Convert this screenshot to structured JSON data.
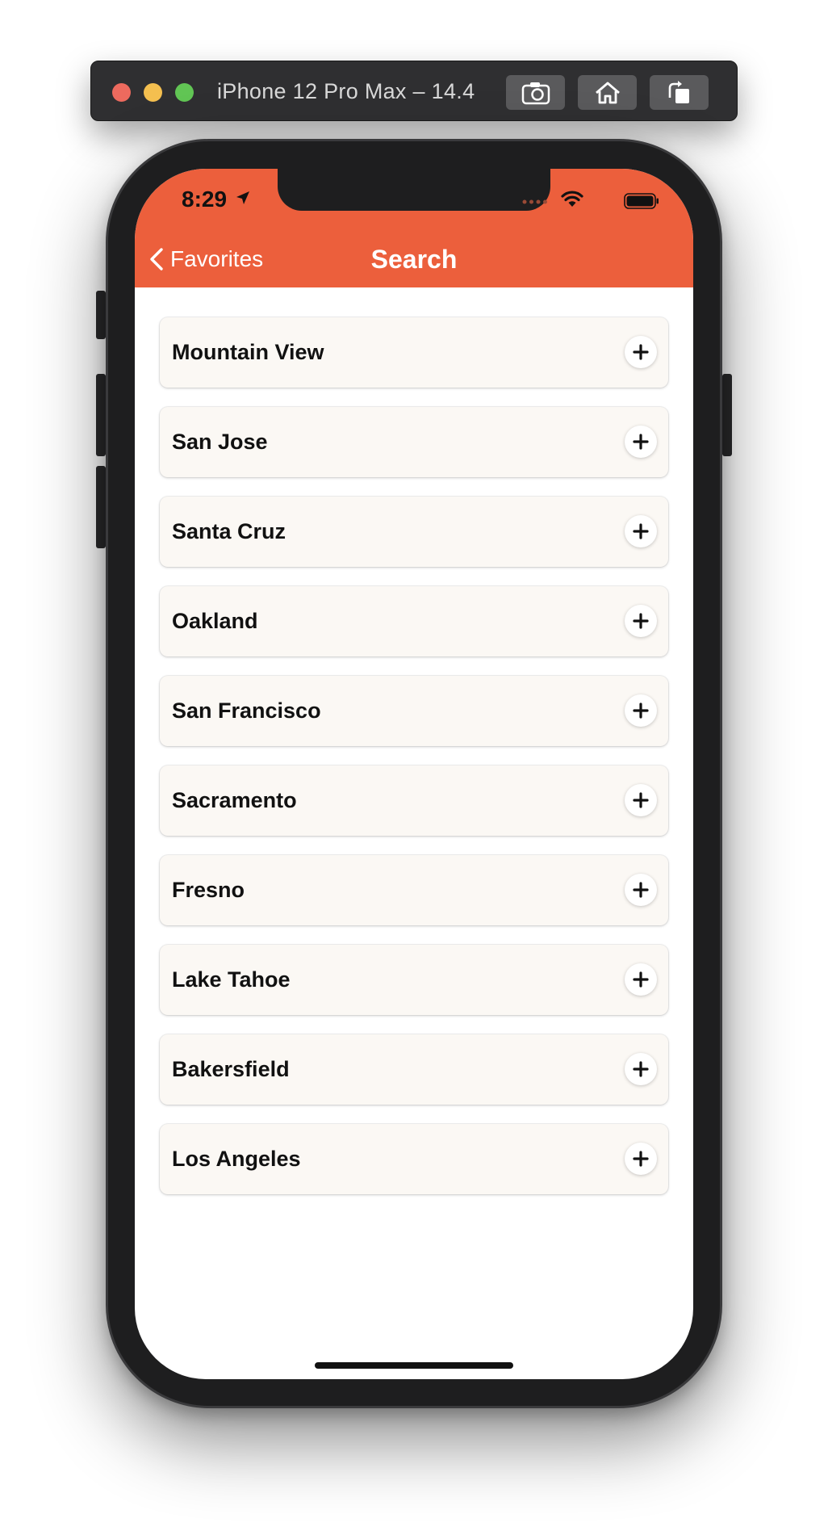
{
  "simulator": {
    "title": "iPhone 12 Pro Max – 14.4",
    "buttons": [
      {
        "icon": "camera-icon"
      },
      {
        "icon": "home-icon"
      },
      {
        "icon": "rotate-icon"
      }
    ]
  },
  "status_bar": {
    "time": "8:29",
    "icons": [
      "location-arrow-icon",
      "signal-dots-icon",
      "wifi-icon",
      "battery-icon"
    ]
  },
  "nav": {
    "back_label": "Favorites",
    "title": "Search"
  },
  "cities": [
    {
      "name": "Mountain View"
    },
    {
      "name": "San Jose"
    },
    {
      "name": "Santa Cruz"
    },
    {
      "name": "Oakland"
    },
    {
      "name": "San Francisco"
    },
    {
      "name": "Sacramento"
    },
    {
      "name": "Fresno"
    },
    {
      "name": "Lake Tahoe"
    },
    {
      "name": "Bakersfield"
    },
    {
      "name": "Los Angeles"
    }
  ],
  "colors": {
    "accent": "#ec5f3c",
    "card_background": "#fbf8f4"
  }
}
